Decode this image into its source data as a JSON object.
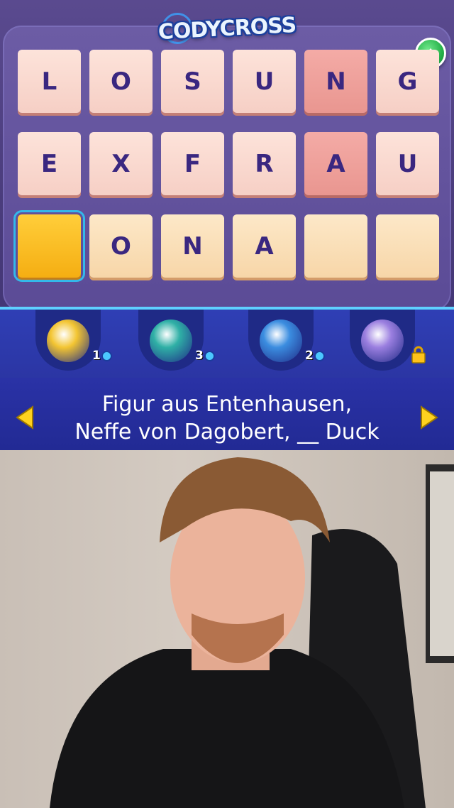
{
  "app": {
    "logo_text": "CODYCROSS"
  },
  "board": {
    "rows": [
      [
        {
          "letter": "L",
          "state": "normal"
        },
        {
          "letter": "O",
          "state": "normal"
        },
        {
          "letter": "S",
          "state": "normal"
        },
        {
          "letter": "U",
          "state": "normal"
        },
        {
          "letter": "N",
          "state": "hint"
        },
        {
          "letter": "G",
          "state": "normal"
        }
      ],
      [
        {
          "letter": "E",
          "state": "normal"
        },
        {
          "letter": "X",
          "state": "normal"
        },
        {
          "letter": "F",
          "state": "normal"
        },
        {
          "letter": "R",
          "state": "normal"
        },
        {
          "letter": "A",
          "state": "hint"
        },
        {
          "letter": "U",
          "state": "normal"
        }
      ],
      [
        {
          "letter": "",
          "state": "selected"
        },
        {
          "letter": "O",
          "state": "answer"
        },
        {
          "letter": "N",
          "state": "answer"
        },
        {
          "letter": "A",
          "state": "answer"
        },
        {
          "letter": "",
          "state": "answer"
        },
        {
          "letter": "",
          "state": "answer"
        }
      ]
    ]
  },
  "helpers": [
    {
      "name": "yellow-bee-helper",
      "count": "1",
      "locked": false,
      "color": "#f3c532"
    },
    {
      "name": "yellow-hood-helper",
      "count": "3",
      "locked": false,
      "color": "#2fb0a6"
    },
    {
      "name": "helmet-helper",
      "count": "2",
      "locked": false,
      "color": "#3b8de0"
    },
    {
      "name": "purple-alien-helper",
      "count": "",
      "locked": true,
      "color": "#9b7fe0"
    }
  ],
  "clue": {
    "text": "Figur aus Entenhausen,\nNeffe von Dagobert, __ Duck"
  },
  "colors": {
    "accent_green": "#26b14a",
    "selected_tile": "#f5ae12",
    "hint_tile": "#e99690",
    "arrow_yellow": "#ffd21f"
  },
  "icons": {
    "up": "triangle-up-icon",
    "prev": "arrow-left-icon",
    "next": "arrow-right-icon",
    "lock": "lock-icon",
    "coin": "coin-icon"
  }
}
